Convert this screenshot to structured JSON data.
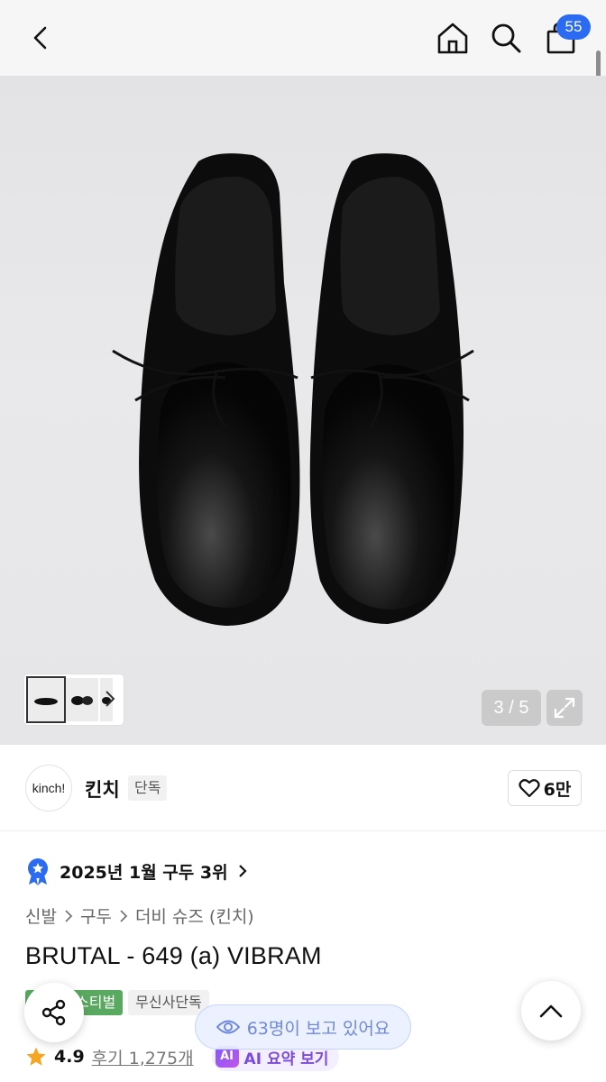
{
  "nav": {
    "back_icon": "chevron-left-icon",
    "home_icon": "home-icon",
    "search_icon": "search-icon",
    "cart_icon": "shopping-bag-icon",
    "cart_count": "55",
    "accent": "#2a6bf2"
  },
  "gallery": {
    "counter": "3 / 5",
    "expand_icon": "expand-icon",
    "thumb_chevron_icon": "chevron-right-icon"
  },
  "brand": {
    "logo_text": "kinch!",
    "name": "킨치",
    "tag": "단독",
    "like_count": "6만",
    "like_icon": "heart-icon"
  },
  "ranking": {
    "text": "2025년 1월 구두 3위",
    "icon": "rank-badge-icon"
  },
  "breadcrumb": {
    "items": [
      "신발",
      "구두",
      "더비 슈즈 (킨치)"
    ]
  },
  "product": {
    "title": "BRUTAL - 649 (a) VIBRAM",
    "tags": [
      "스티벌",
      "무신사단독"
    ],
    "rating": "4.9",
    "review_text": "후기 1,275개",
    "ai_badge": "AI",
    "ai_label": "AI 요약 보기",
    "tag_green_color": "#5aa961"
  },
  "floating": {
    "viewers_text": "63명이 보고 있어요",
    "share_icon": "share-icon",
    "eye_icon": "eye-icon",
    "top_icon": "chevron-up-icon"
  }
}
